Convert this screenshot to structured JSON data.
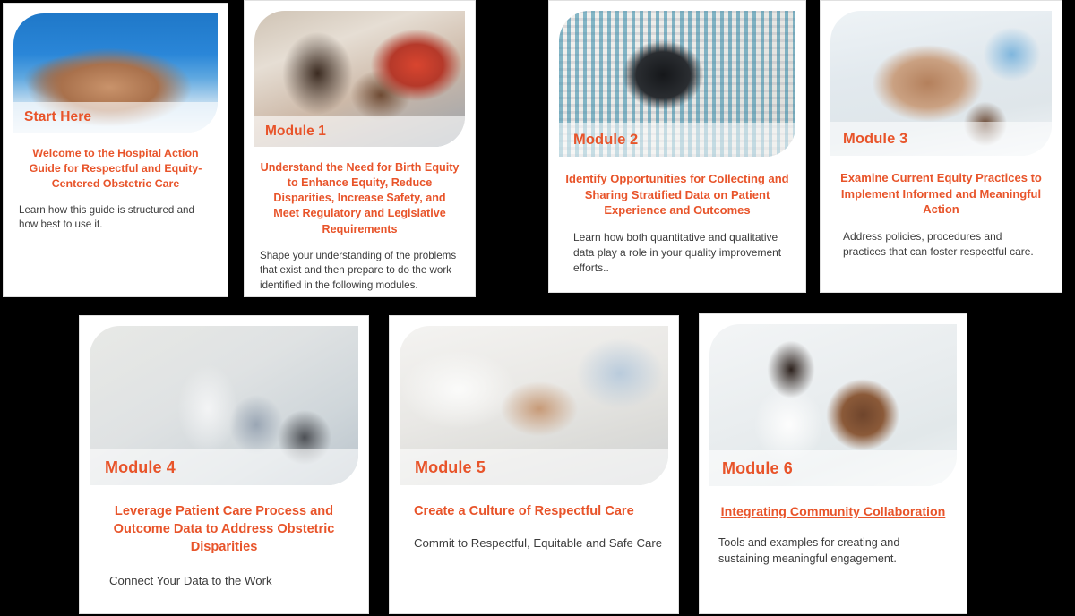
{
  "theme": {
    "page_background": "#000000",
    "card_background": "#ffffff",
    "accent_color": "#E8542A",
    "body_text_color": "#3c3c3c"
  },
  "cards": [
    {
      "badge": "Start Here",
      "title": "Welcome to the Hospital Action Guide for Respectful and Equity-Centered Obstetric Care",
      "description": "Learn how this guide is structured and how best to use it.",
      "image_name": "clasped-hands-photo"
    },
    {
      "badge": "Module 1",
      "title": "Understand the Need for Birth Equity to Enhance Equity, Reduce Disparities, Increase Safety, and Meet Regulatory and Legislative Requirements",
      "description": "Shape your understanding of the problems that exist and then prepare to do the work identified in the following modules.",
      "image_name": "family-with-newborn-photo"
    },
    {
      "badge": "Module 2",
      "title": "Identify Opportunities for Collecting and Sharing Stratified Data on Patient Experience and Outcomes",
      "description": "Learn how both quantitative and qualitative data play a role in your quality improvement efforts..",
      "image_name": "charts-and-stethoscope-photo"
    },
    {
      "badge": "Module 3",
      "title": "Examine Current Equity Practices to Implement Informed and Meaningful Action",
      "description": "Address policies, procedures and practices that can foster respectful care.",
      "image_name": "hands-together-photo"
    },
    {
      "badge": "Module 4",
      "title": "Leverage Patient Care Process and Outcome Data to Address Obstetric Disparities",
      "description": "Connect Your Data to the Work",
      "image_name": "presentation-meeting-photo"
    },
    {
      "badge": "Module 5",
      "title": "Create a Culture of Respectful Care",
      "description": "Commit to Respectful, Equitable and Safe Care",
      "image_name": "bedside-hands-photo"
    },
    {
      "badge": "Module 6",
      "title": "Integrating Community Collaboration",
      "description": "Tools and examples for creating and sustaining meaningful engagement.",
      "image_name": "handshake-photo"
    }
  ]
}
